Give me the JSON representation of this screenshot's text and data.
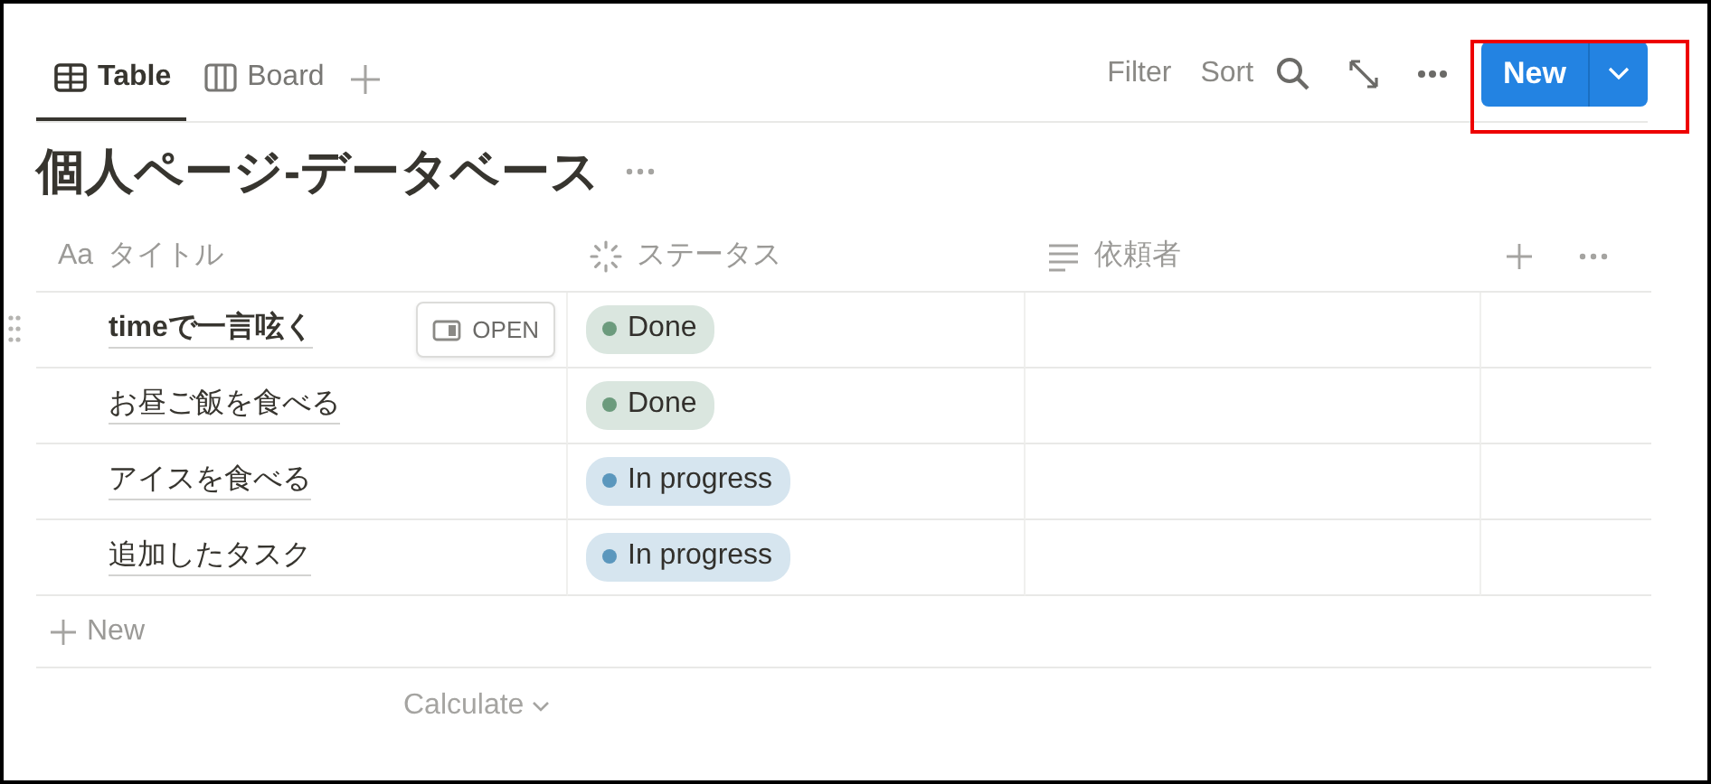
{
  "tabs": [
    {
      "label": "Table",
      "kind": "table",
      "selected": true
    },
    {
      "label": "Board",
      "kind": "board",
      "selected": false
    }
  ],
  "toolbar": {
    "filter": "Filter",
    "sort": "Sort"
  },
  "new_button": {
    "label": "New",
    "highlighted": true
  },
  "title": "個人ページ-データベース",
  "columns": [
    {
      "label": "タイトル",
      "kind": "text",
      "prefix": "Aa"
    },
    {
      "label": "ステータス",
      "kind": "status"
    },
    {
      "label": "依頼者",
      "kind": "lines"
    }
  ],
  "rows": [
    {
      "title": "timeで一言呟く",
      "hovered": true,
      "open_button": "OPEN",
      "status": {
        "label": "Done",
        "color": "#6c9b7d"
      }
    },
    {
      "title": "お昼ご飯を食べる",
      "hovered": false,
      "status": {
        "label": "Done",
        "color": "#6c9b7d"
      }
    },
    {
      "title": "アイスを食べる",
      "hovered": false,
      "status": {
        "label": "In progress",
        "color": "#5b97bd"
      }
    },
    {
      "title": "追加したタスク",
      "hovered": false,
      "status": {
        "label": "In progress",
        "color": "#5b97bd"
      }
    }
  ],
  "add_row": "New",
  "calculate": "Calculate"
}
